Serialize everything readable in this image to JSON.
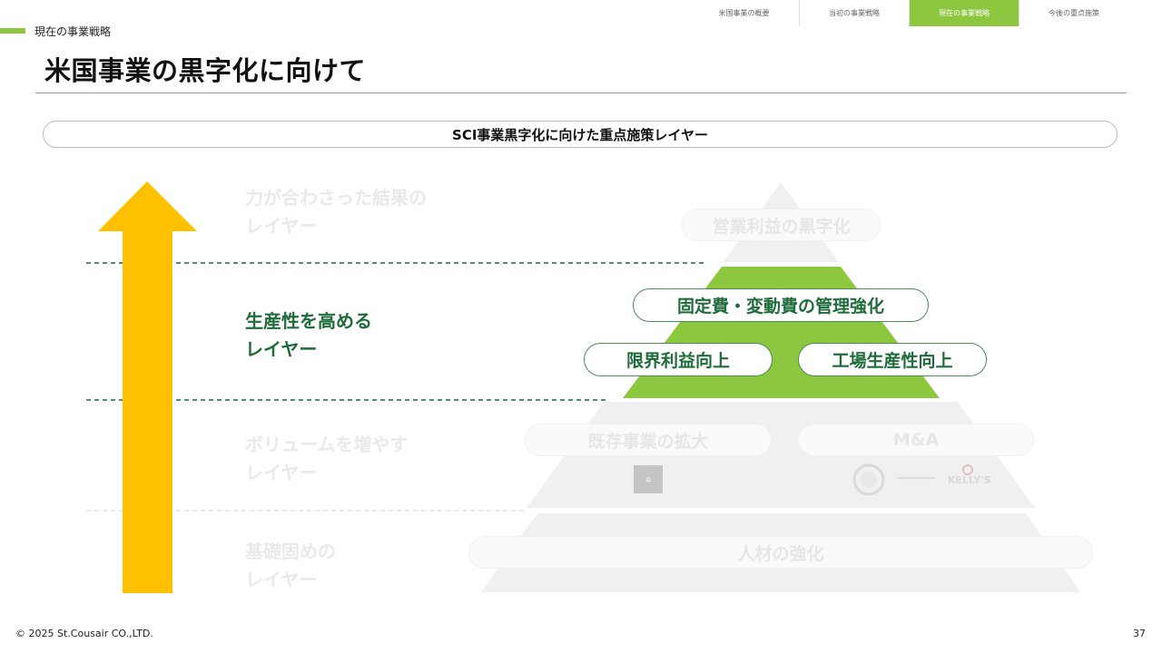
{
  "nav": {
    "tabs": [
      {
        "label": "米国事業の概要"
      },
      {
        "label": "当初の事業戦略"
      },
      {
        "label": "現在の事業戦略",
        "active": true
      },
      {
        "label": "今後の重点施策"
      }
    ]
  },
  "section_label": "現在の事業戦略",
  "page_title": "米国事業の黒字化に向けて",
  "banner": "SCI事業黒字化に向けた重点施策レイヤー",
  "layers": [
    {
      "label": "力が合わさった結果の\nレイヤー",
      "state": "faded"
    },
    {
      "label": "生産性を高める\nレイヤー",
      "state": "active"
    },
    {
      "label": "ボリュームを増やす\nレイヤー",
      "state": "faded"
    },
    {
      "label": "基礎固めの\nレイヤー",
      "state": "faded"
    }
  ],
  "pyramid": {
    "top": "営業利益の黒字化",
    "productivity": {
      "main": "固定費・変動費の管理強化",
      "left": "限界利益向上",
      "right": "工場生産性向上"
    },
    "volume": {
      "left": "既存事業の拡大",
      "right": "M&A"
    },
    "base": "人材の強化"
  },
  "brand_logo": "KELLY'S",
  "colors": {
    "accent_green": "#8dc63f",
    "text_green": "#1f6b3a",
    "arrow_yellow": "#ffc000",
    "faded_gray": "#f0f0f0"
  },
  "footer": {
    "copyright": "© 2025 St.Cousair CO.,LTD.",
    "page_number": "37"
  }
}
